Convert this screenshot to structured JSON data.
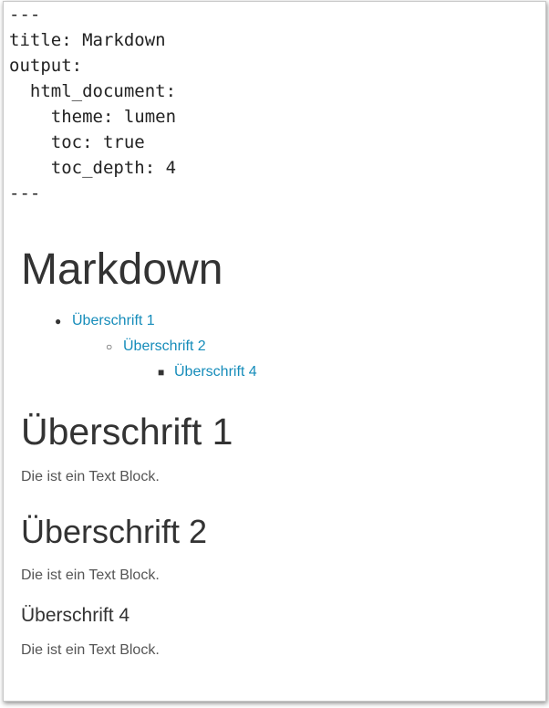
{
  "yaml_header": {
    "lines": [
      "---",
      "title: Markdown",
      "output:",
      "  html_document:",
      "    theme: lumen",
      "    toc: true",
      "    toc_depth: 4",
      "---"
    ]
  },
  "document": {
    "title": "Markdown",
    "toc": [
      {
        "label": "Überschrift 1"
      },
      {
        "label": "Überschrift 2"
      },
      {
        "label": "Überschrift 4"
      }
    ],
    "sections": [
      {
        "heading": "Überschrift 1",
        "text": "Die ist ein Text Block."
      },
      {
        "heading": "Überschrift 2",
        "text": "Die ist ein Text Block."
      },
      {
        "heading": "Überschrift 4",
        "text": "Die ist ein Text Block."
      }
    ]
  },
  "colors": {
    "link": "#158cba",
    "text": "#333333"
  }
}
